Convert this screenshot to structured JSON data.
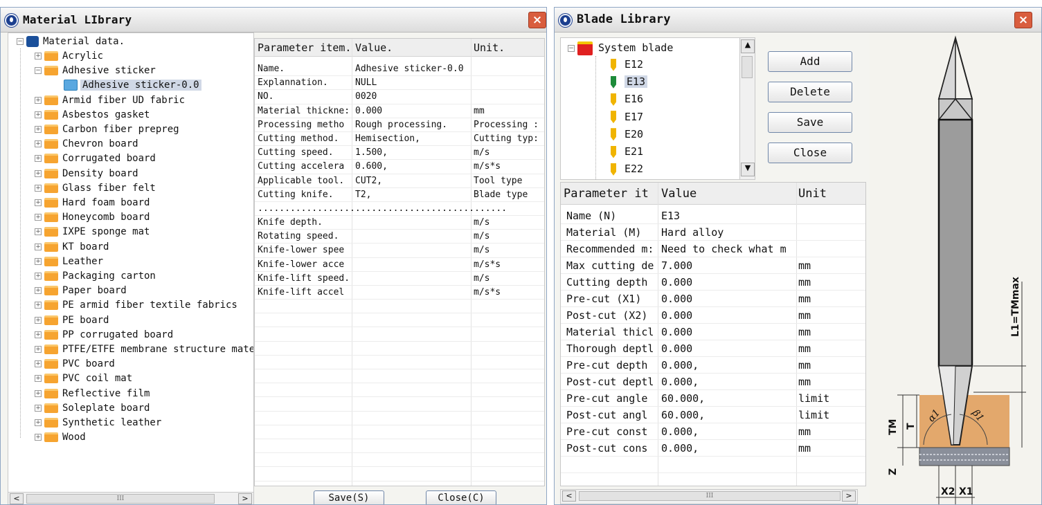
{
  "material_library": {
    "title": "Material LIbrary",
    "close_glyph": "×",
    "tree": {
      "root": "Material data.",
      "items": [
        "Acrylic",
        "Adhesive sticker",
        "Armid fiber UD fabric",
        "Asbestos gasket",
        "Carbon fiber prepreg",
        "Chevron board",
        "Corrugated board",
        "Density board",
        "Glass fiber felt",
        "Hard foam board",
        "Honeycomb board",
        "IXPE sponge mat",
        "KT board",
        "Leather",
        "Packaging carton",
        "Paper board",
        "PE armid fiber textile fabrics",
        "PE board",
        "PP corrugated board",
        "PTFE/ETFE membrane structure mate",
        "PVC board",
        "PVC coil mat",
        "Reflective film",
        "Soleplate board",
        "Synthetic leather",
        "Wood"
      ],
      "selected_child": "Adhesive sticker-0.0",
      "expanded_index": 1
    },
    "params": {
      "headers": [
        "Parameter item.",
        "Value.",
        "Unit."
      ],
      "rows": [
        [
          "Name.",
          "Adhesive sticker-0.0",
          ""
        ],
        [
          "Explannation.",
          "NULL",
          ""
        ],
        [
          "NO.",
          "0020",
          ""
        ],
        [
          "Material thickne:",
          "0.000",
          "mm"
        ],
        [
          "Processing metho",
          "Rough processing.",
          "Processing :"
        ],
        [
          "Cutting method.",
          "Hemisection,",
          "Cutting typ:"
        ],
        [
          "Cutting speed.",
          "1.500,",
          "m/s"
        ],
        [
          "Cutting accelera",
          "0.600,",
          "m/s*s"
        ],
        [
          "Applicable tool.",
          "CUT2,",
          "Tool type"
        ],
        [
          "Cutting knife.",
          "T2,",
          "Blade type"
        ]
      ],
      "separator": "..............................................",
      "rows2": [
        [
          "Knife depth.",
          "",
          "m/s"
        ],
        [
          "Rotating speed.",
          "",
          "m/s"
        ],
        [
          "Knife-lower spee",
          "",
          "m/s"
        ],
        [
          "Knife-lower acce",
          "",
          "m/s*s"
        ],
        [
          "Knife-lift speed.",
          "",
          "m/s"
        ],
        [
          "Knife-lift accel",
          "",
          "m/s*s"
        ]
      ]
    },
    "buttons": {
      "save": "Save(S)",
      "close": "Close(C)"
    },
    "scroll": {
      "left": "<",
      "right": ">",
      "thumb": "III"
    }
  },
  "blade_library": {
    "title": "Blade Library",
    "close_glyph": "×",
    "tree": {
      "root": "System blade",
      "items": [
        "E12",
        "E13",
        "E16",
        "E17",
        "E20",
        "E21",
        "E22"
      ],
      "selected": "E13"
    },
    "buttons": {
      "add": "Add",
      "delete": "Delete",
      "save": "Save",
      "close": "Close"
    },
    "params": {
      "headers": [
        "Parameter it",
        "Value",
        "Unit"
      ],
      "rows": [
        [
          "Name (N)",
          "E13",
          ""
        ],
        [
          "Material (M)",
          "Hard alloy",
          ""
        ],
        [
          "Recommended m:",
          "Need to check what m",
          ""
        ],
        [
          "Max cutting de",
          "7.000",
          "mm"
        ],
        [
          "Cutting depth",
          "0.000",
          "mm"
        ],
        [
          "Pre-cut (X1)",
          "0.000",
          "mm"
        ],
        [
          "Post-cut (X2)",
          "0.000",
          "mm"
        ],
        [
          "Material thicl",
          "0.000",
          "mm"
        ],
        [
          "Thorough deptl",
          "0.000",
          "mm"
        ],
        [
          "Pre-cut depth",
          "0.000,",
          "mm"
        ],
        [
          "Post-cut deptl",
          "0.000,",
          "mm"
        ],
        [
          "Pre-cut angle",
          "60.000,",
          "limit"
        ],
        [
          "Post-cut angl",
          "60.000,",
          "limit"
        ],
        [
          "Pre-cut const",
          "0.000,",
          "mm"
        ],
        [
          "Post-cut cons",
          "0.000,",
          "mm"
        ]
      ]
    },
    "diagram_labels": {
      "l1": "L1=TMmax",
      "tm": "TM",
      "t": "T",
      "z": "Z",
      "a1": "α1",
      "b1": "β1",
      "x2": "X2",
      "x1": "X1"
    },
    "scroll": {
      "left": "<",
      "right": ">",
      "thumb": "III",
      "up": "▲",
      "down": "▼"
    }
  },
  "colors": {
    "folder": "#f6a430",
    "accent_blue": "#1c3f8f",
    "close_red": "#d95d3e",
    "blade_yellow": "#f0b400",
    "blade_green": "#1d8b3a"
  }
}
